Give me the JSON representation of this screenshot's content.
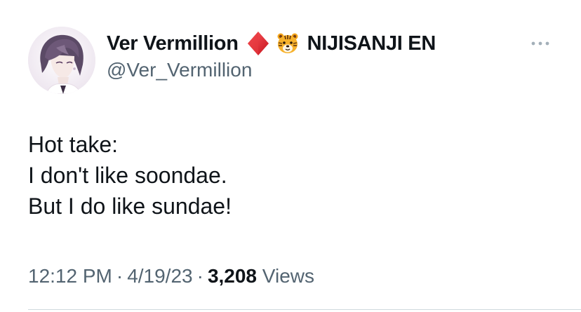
{
  "author": {
    "display_name": "Ver Vermillion",
    "handle": "@Ver_Vermillion",
    "affiliation": "NIJISANJI EN",
    "badge_icons": [
      "red-diamond-icon",
      "tiger-face-icon"
    ],
    "avatar_icon": "avatar-image"
  },
  "tweet": {
    "lines": [
      "Hot take:",
      "I don't like soondae.",
      "But I do like sundae!"
    ],
    "time": "12:12 PM",
    "date": "4/19/23",
    "separator": "·",
    "views_count": "3,208",
    "views_label": "Views"
  },
  "menu": {
    "more_icon": "more-options-icon"
  },
  "colors": {
    "text_primary": "#0f1419",
    "text_secondary": "#536471",
    "diamond": "#e0202a",
    "divider": "#cfd9de"
  }
}
